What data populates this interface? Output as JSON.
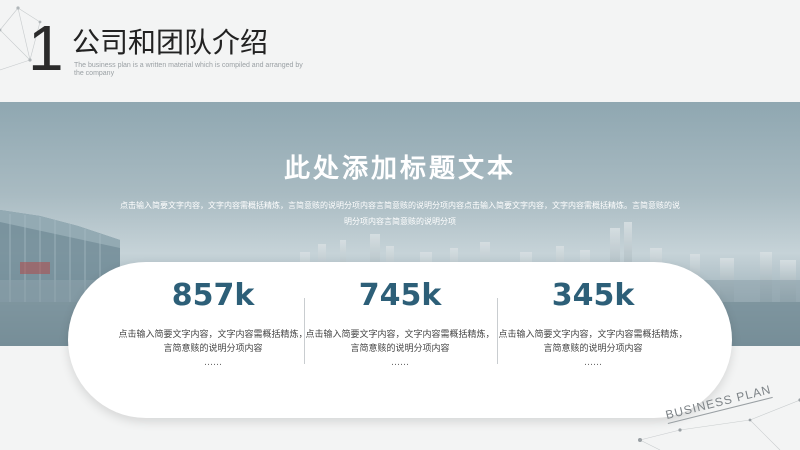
{
  "header": {
    "number": "1",
    "title": "公司和团队介绍",
    "subtitle": "The business plan is a written material which is compiled and arranged by the company"
  },
  "banner": {
    "title": "此处添加标题文本",
    "text": "点击输入简要文字内容，文字内容需概括精炼，言简意赅的说明分项内容言简意赅的说明分项内容点击输入简要文字内容，文字内容需概括精炼。言简意赅的说明分项内容言简意赅的说明分项"
  },
  "stats": [
    {
      "value": "857k",
      "desc": "点击输入简要文字内容，文字内容需概括精炼，言简意赅的说明分项内容",
      "more": "……"
    },
    {
      "value": "745k",
      "desc": "点击输入简要文字内容，文字内容需概括精炼，言简意赅的说明分项内容",
      "more": "……"
    },
    {
      "value": "345k",
      "desc": "点击输入简要文字内容，文字内容需概括精炼，言简意赅的说明分项内容",
      "more": "……"
    }
  ],
  "footer": {
    "badge": "BUSINESS PLAN"
  },
  "colors": {
    "accent": "#2d5f78",
    "banner": "#a9bbc2",
    "card": "#ffffff"
  }
}
